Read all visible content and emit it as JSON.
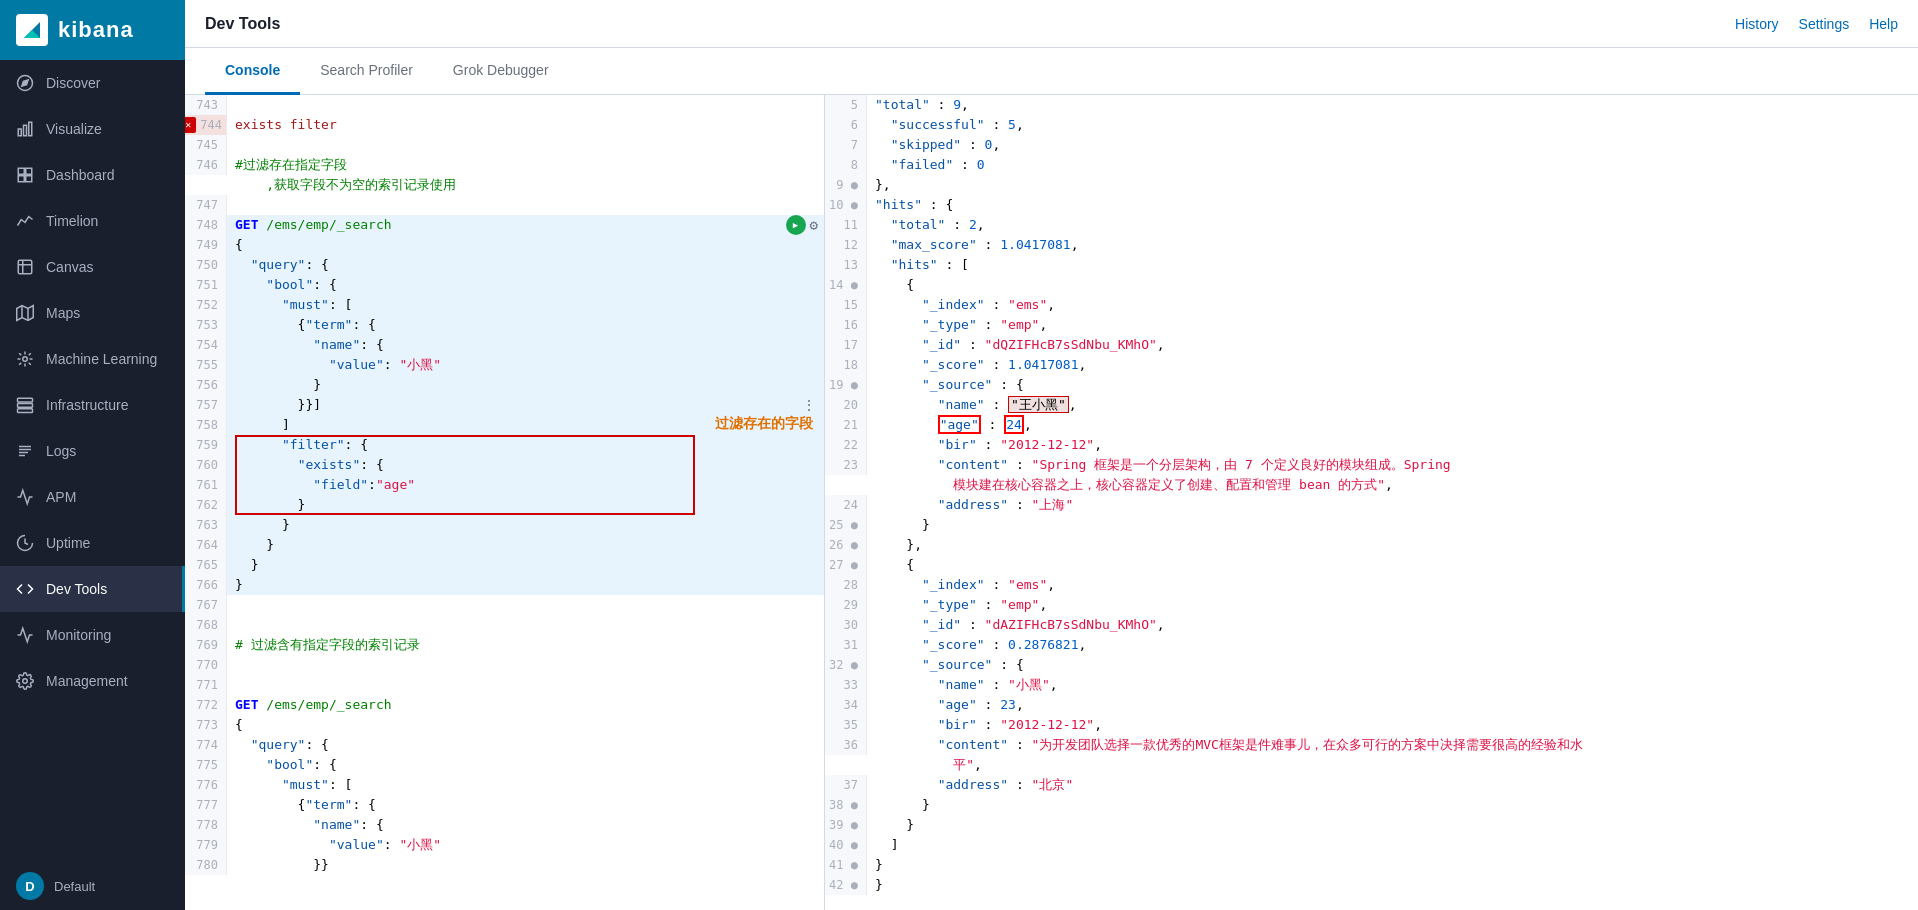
{
  "app": {
    "title": "kibana"
  },
  "topbar": {
    "title": "Dev Tools",
    "actions": [
      "History",
      "Settings",
      "Help"
    ]
  },
  "tabs": [
    {
      "id": "console",
      "label": "Console",
      "active": true
    },
    {
      "id": "search-profiler",
      "label": "Search Profiler",
      "active": false
    },
    {
      "id": "grok-debugger",
      "label": "Grok Debugger",
      "active": false
    }
  ],
  "sidebar": {
    "items": [
      {
        "id": "discover",
        "label": "Discover",
        "icon": "compass"
      },
      {
        "id": "visualize",
        "label": "Visualize",
        "icon": "bar-chart"
      },
      {
        "id": "dashboard",
        "label": "Dashboard",
        "icon": "dashboard"
      },
      {
        "id": "timelion",
        "label": "Timelion",
        "icon": "timelion"
      },
      {
        "id": "canvas",
        "label": "Canvas",
        "icon": "canvas"
      },
      {
        "id": "maps",
        "label": "Maps",
        "icon": "maps"
      },
      {
        "id": "machine-learning",
        "label": "Machine Learning",
        "icon": "ml"
      },
      {
        "id": "infrastructure",
        "label": "Infrastructure",
        "icon": "infra"
      },
      {
        "id": "logs",
        "label": "Logs",
        "icon": "logs"
      },
      {
        "id": "apm",
        "label": "APM",
        "icon": "apm"
      },
      {
        "id": "uptime",
        "label": "Uptime",
        "icon": "uptime"
      },
      {
        "id": "dev-tools",
        "label": "Dev Tools",
        "icon": "devtools",
        "active": true
      },
      {
        "id": "monitoring",
        "label": "Monitoring",
        "icon": "monitoring"
      },
      {
        "id": "management",
        "label": "Management",
        "icon": "management"
      }
    ],
    "user": {
      "label": "Default",
      "avatar": "D"
    }
  }
}
